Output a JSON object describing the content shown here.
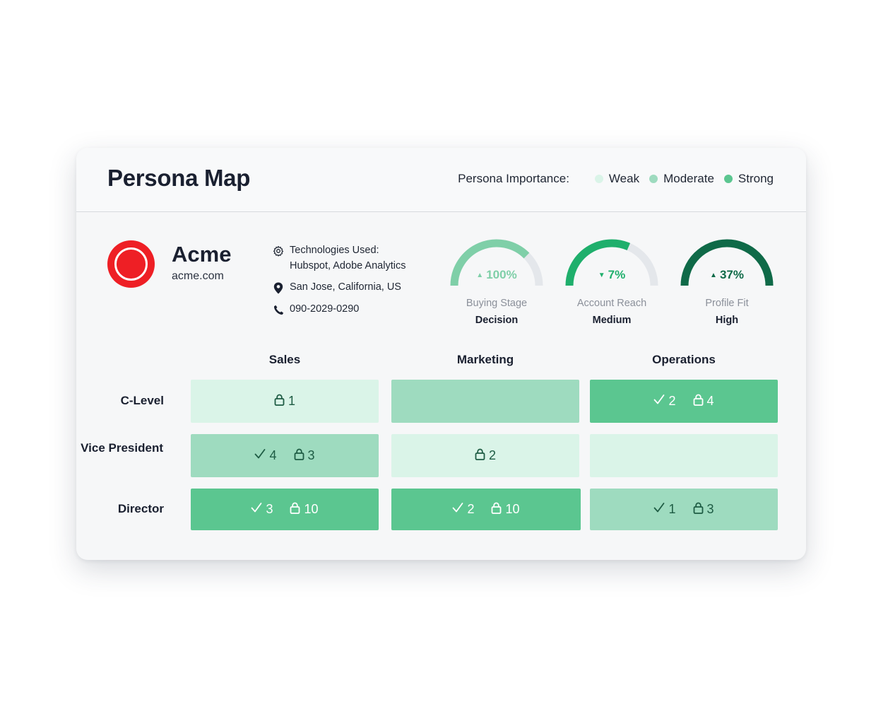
{
  "colors": {
    "weak": "#daf4e8",
    "moderate": "#9edbbf",
    "strong": "#5bc690",
    "buying_stage": "#7fcfa8",
    "account_reach": "#1faf6c",
    "profile_fit": "#0f6a48",
    "gauge_track": "#e4e7eb",
    "logo": "#ee1f25"
  },
  "header": {
    "title": "Persona Map",
    "legend": {
      "label": "Persona Importance:",
      "items": [
        {
          "label": "Weak",
          "level": "weak"
        },
        {
          "label": "Moderate",
          "level": "moderate"
        },
        {
          "label": "Strong",
          "level": "strong"
        }
      ]
    }
  },
  "company": {
    "name": "Acme",
    "url": "acme.com",
    "technologies_label": "Technologies Used:",
    "technologies": "Hubspot, Adobe Analytics",
    "location": "San Jose, California, US",
    "phone": "090-2029-0290",
    "icons": [
      "gear-icon",
      "location-pin-icon",
      "phone-icon"
    ]
  },
  "gauges": [
    {
      "value": "100%",
      "trend": "up",
      "fill": 0.75,
      "label": "Buying Stage",
      "level": "Decision",
      "color_key": "buying_stage"
    },
    {
      "value": "7%",
      "trend": "down",
      "fill": 0.63,
      "label": "Account Reach",
      "level": "Medium",
      "color_key": "account_reach"
    },
    {
      "value": "37%",
      "trend": "up",
      "fill": 1.0,
      "label": "Profile Fit",
      "level": "High",
      "color_key": "profile_fit"
    }
  ],
  "grid": {
    "columns": [
      "Sales",
      "Marketing",
      "Operations"
    ],
    "rows": [
      {
        "label": "C-Level",
        "cells": [
          {
            "level": "weak",
            "checks": null,
            "locks": 1
          },
          {
            "level": "moderate",
            "checks": null,
            "locks": null
          },
          {
            "level": "strong",
            "checks": 2,
            "locks": 4
          }
        ]
      },
      {
        "label": "Vice President",
        "cells": [
          {
            "level": "moderate",
            "checks": 4,
            "locks": 3
          },
          {
            "level": "weak",
            "checks": null,
            "locks": 2
          },
          {
            "level": "weak",
            "checks": null,
            "locks": null
          }
        ]
      },
      {
        "label": "Director",
        "cells": [
          {
            "level": "strong",
            "checks": 3,
            "locks": 10
          },
          {
            "level": "strong",
            "checks": 2,
            "locks": 10
          },
          {
            "level": "moderate",
            "checks": 1,
            "locks": 3
          }
        ]
      }
    ]
  }
}
